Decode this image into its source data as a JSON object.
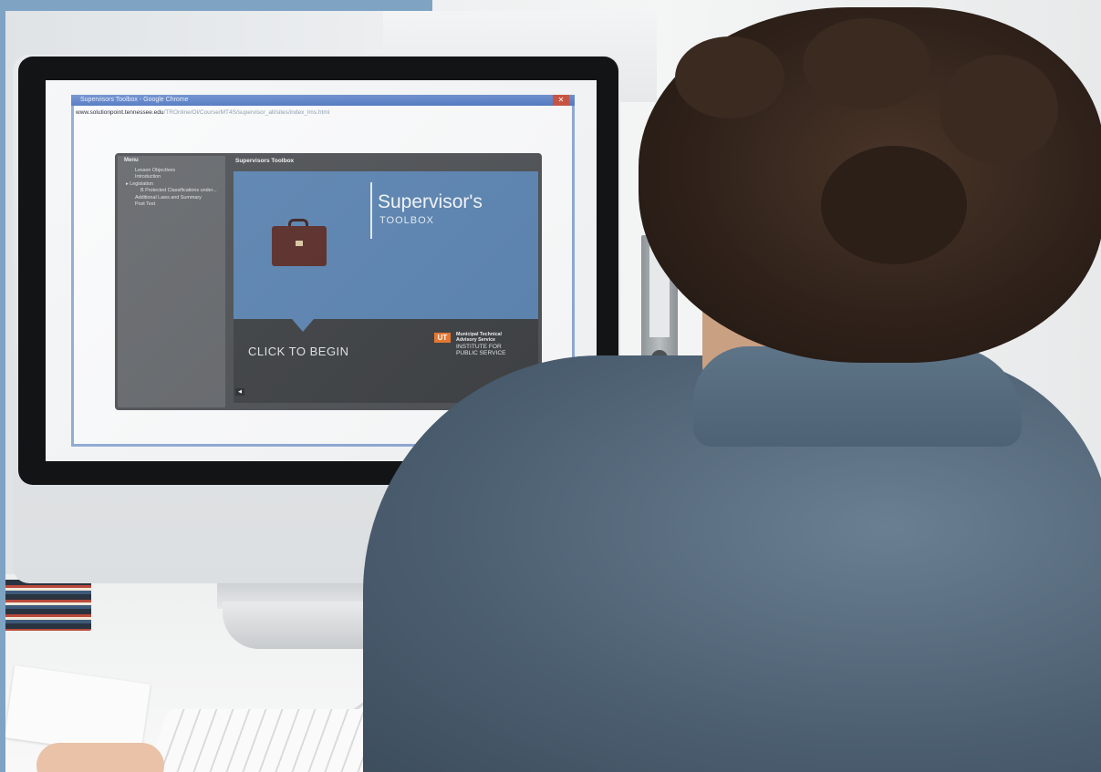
{
  "browser": {
    "title": "Supervisors Toolbox - Google Chrome",
    "url_host": "www.solutionpoint.tennessee.edu",
    "url_path": "/TROnline/Ol/Course/MT4S/supervisor_all/sites/index_lms.html"
  },
  "course": {
    "header_title": "Supervisors Toolbox",
    "menu_title": "Menu",
    "menu_items": [
      {
        "label": "Lesson Objectives"
      },
      {
        "label": "Introduction"
      },
      {
        "label": "Legislation"
      },
      {
        "label": "B Protected Classifications under..."
      },
      {
        "label": "Additional Laws and Summary"
      },
      {
        "label": "Post Test"
      }
    ],
    "slide_title": "Supervisor's",
    "slide_subtitle": "TOOLBOX",
    "cta": "CLICK TO BEGIN",
    "logo_mark": "UT",
    "org_line1": "Municipal Technical",
    "org_line2": "Advisory Service",
    "org_line3": "INSTITUTE FOR",
    "org_line4": "PUBLIC SERVICE",
    "audio_icon": "speaker-icon"
  },
  "colors": {
    "slide_blue": "#5b84b1",
    "player_gray": "#4e5155",
    "logo_orange": "#e8782e",
    "frame_blue": "#7fa3c3"
  }
}
